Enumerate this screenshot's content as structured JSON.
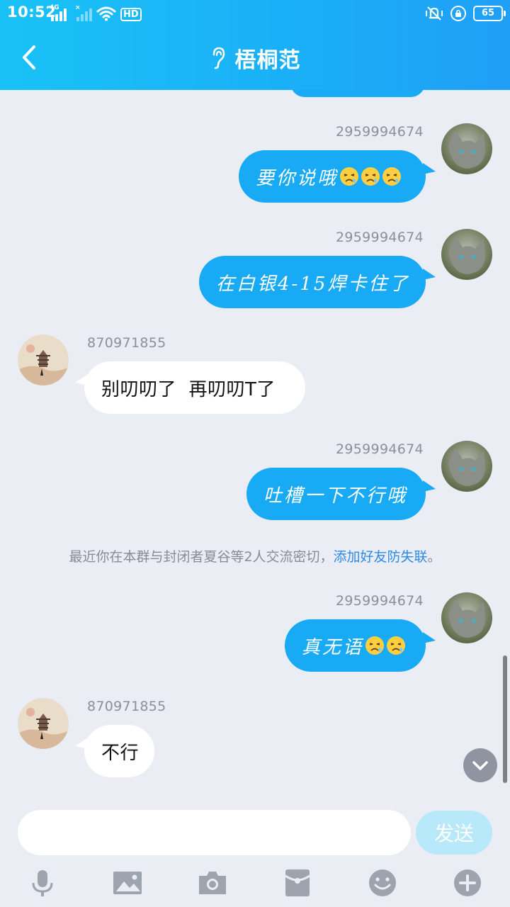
{
  "status_bar": {
    "time": "10:52",
    "network_type": "4G",
    "hd_badge": "HD",
    "battery": "65",
    "colors": {
      "header_start": "#19c2f6",
      "header_end": "#1f9ff6"
    }
  },
  "header": {
    "title": "梧桐范",
    "back_icon": "back-arrow-icon",
    "ear_icon": "ear-icon"
  },
  "messages": [
    {
      "sender_id": "2959994674",
      "direction": "outgoing",
      "text": "要你说哦",
      "emoji": [
        "tired-face-emoji",
        "tired-face-emoji",
        "tired-face-emoji"
      ]
    },
    {
      "sender_id": "2959994674",
      "direction": "outgoing",
      "text": "在白银4-15焊卡住了",
      "emoji": []
    },
    {
      "sender_id": "870971855",
      "direction": "incoming",
      "text": "别叨叨了  再叨叨T了",
      "emoji": []
    },
    {
      "sender_id": "2959994674",
      "direction": "outgoing",
      "text": "吐槽一下不行哦",
      "emoji": []
    },
    {
      "sender_id": "2959994674",
      "direction": "outgoing",
      "text": "真无语",
      "emoji": [
        "tired-face-emoji",
        "tired-face-emoji"
      ]
    },
    {
      "sender_id": "870971855",
      "direction": "incoming",
      "text": "不行",
      "emoji": []
    }
  ],
  "system_note": {
    "text": "最近你在本群与封闭者夏谷等2人交流密切，",
    "link": "添加好友防失联",
    "suffix": "。"
  },
  "input": {
    "value": "",
    "placeholder": ""
  },
  "send_label": "发送",
  "toolbar": [
    "microphone-icon",
    "image-icon",
    "camera-icon",
    "red-packet-icon",
    "emoji-icon",
    "plus-icon"
  ],
  "colors": {
    "outgoing_bubble": "#18aaf4",
    "incoming_bubble": "#ffffff",
    "link": "#2d8ae6",
    "background": "#eaedf4"
  }
}
